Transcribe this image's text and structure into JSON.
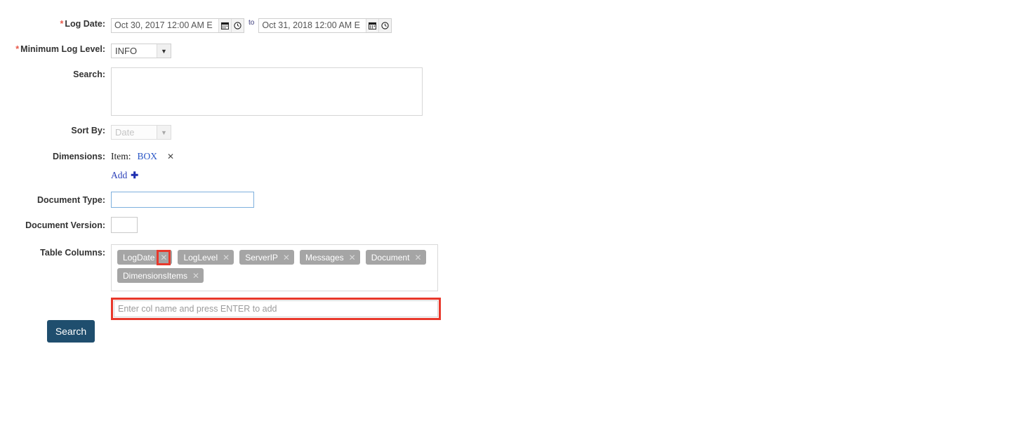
{
  "form": {
    "log_date": {
      "label": "Log Date:",
      "required": true,
      "from_value": "Oct 30, 2017 12:00 AM E",
      "to_value": "Oct 31, 2018 12:00 AM E",
      "separator": "to",
      "calendar_icon": "calendar-icon",
      "clock_icon": "clock-icon"
    },
    "min_log_level": {
      "label": "Minimum Log Level:",
      "required": true,
      "value": "INFO",
      "options": [
        "INFO"
      ]
    },
    "search": {
      "label": "Search:",
      "value": "",
      "placeholder": ""
    },
    "sort_by": {
      "label": "Sort By:",
      "value": "Date",
      "disabled": true,
      "options": [
        "Date"
      ]
    },
    "dimensions": {
      "label": "Dimensions:",
      "items": [
        {
          "key": "Item:",
          "value": "BOX",
          "remove": "✕"
        }
      ],
      "add_label": "Add",
      "add_icon": "✚"
    },
    "document_type": {
      "label": "Document Type:",
      "value": "",
      "focused": true
    },
    "document_version": {
      "label": "Document Version:",
      "value": ""
    },
    "table_columns": {
      "label": "Table Columns:",
      "tags": [
        {
          "name": "LogDate",
          "remove": "✕",
          "highlighted": true
        },
        {
          "name": "LogLevel",
          "remove": "✕",
          "highlighted": false
        },
        {
          "name": "ServerIP",
          "remove": "✕",
          "highlighted": false
        },
        {
          "name": "Messages",
          "remove": "✕",
          "highlighted": false
        },
        {
          "name": "Document",
          "remove": "✕",
          "highlighted": false
        },
        {
          "name": "DimensionsItems",
          "remove": "✕",
          "highlighted": false
        }
      ],
      "add_input_placeholder": "Enter col name and press ENTER to add",
      "add_input_value": ""
    },
    "submit": {
      "label": "Search"
    }
  },
  "colors": {
    "required_star": "#e8594a",
    "highlight": "#e8382b",
    "tag_bg": "#a5a5a5",
    "link": "#2a56c6",
    "button_bg": "#1f4e6e",
    "focus_border": "#7eb0dd"
  }
}
